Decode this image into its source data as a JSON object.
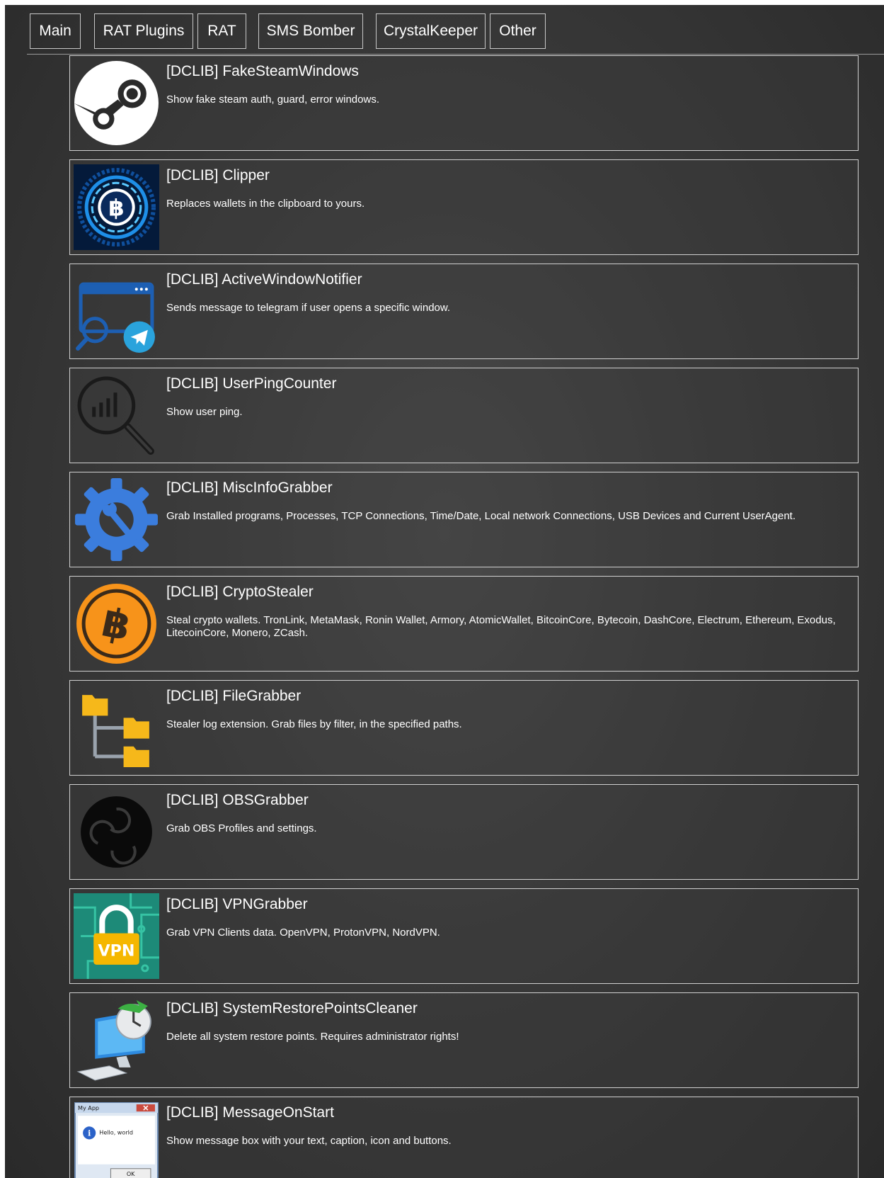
{
  "tabs": [
    {
      "label": "Main"
    },
    {
      "label": "RAT Plugins"
    },
    {
      "label": "RAT"
    },
    {
      "label": "SMS Bomber"
    },
    {
      "label": "CrystalKeeper"
    },
    {
      "label": "Other"
    }
  ],
  "plugins": [
    {
      "title": "[DCLIB] FakeSteamWindows",
      "description": "Show fake steam auth, guard, error windows.",
      "icon": "steam-logo-icon"
    },
    {
      "title": "[DCLIB] Clipper",
      "description": "Replaces wallets in the clipboard to yours.",
      "icon": "bitcoin-circuit-icon"
    },
    {
      "title": "[DCLIB] ActiveWindowNotifier",
      "description": "Sends message to telegram if user opens a specific window.",
      "icon": "window-telegram-icon"
    },
    {
      "title": "[DCLIB] UserPingCounter",
      "description": "Show user ping.",
      "icon": "magnifier-chart-icon"
    },
    {
      "title": "[DCLIB] MiscInfoGrabber",
      "description": "Grab Installed programs, Processes, TCP Connections, Time/Date, Local network Connections, USB Devices and Current UserAgent.",
      "icon": "gear-wrench-icon"
    },
    {
      "title": "[DCLIB] CryptoStealer",
      "description": "Steal crypto wallets. TronLink, MetaMask, Ronin Wallet, Armory, AtomicWallet, BitcoinCore, Bytecoin, DashCore, Electrum, Ethereum, Exodus, LitecoinCore, Monero, ZCash.",
      "icon": "bitcoin-coin-icon"
    },
    {
      "title": "[DCLIB] FileGrabber",
      "description": "Stealer log extension. Grab files by filter, in the specified paths.",
      "icon": "folder-tree-icon"
    },
    {
      "title": "[DCLIB] OBSGrabber",
      "description": "Grab OBS Profiles and settings.",
      "icon": "obs-logo-icon"
    },
    {
      "title": "[DCLIB] VPNGrabber",
      "description": "Grab VPN Clients data. OpenVPN, ProtonVPN, NordVPN.",
      "icon": "vpn-lock-icon",
      "icon_text": "VPN"
    },
    {
      "title": "[DCLIB] SystemRestorePointsCleaner",
      "description": "Delete all system restore points. Requires administrator rights!",
      "icon": "computer-restore-icon"
    },
    {
      "title": "[DCLIB] MessageOnStart",
      "description": "Show message box with your text, caption, icon and buttons.",
      "icon": "message-box-icon",
      "icon_texts": {
        "caption": "My App",
        "message": "Hello, world",
        "button": "OK"
      }
    }
  ]
}
